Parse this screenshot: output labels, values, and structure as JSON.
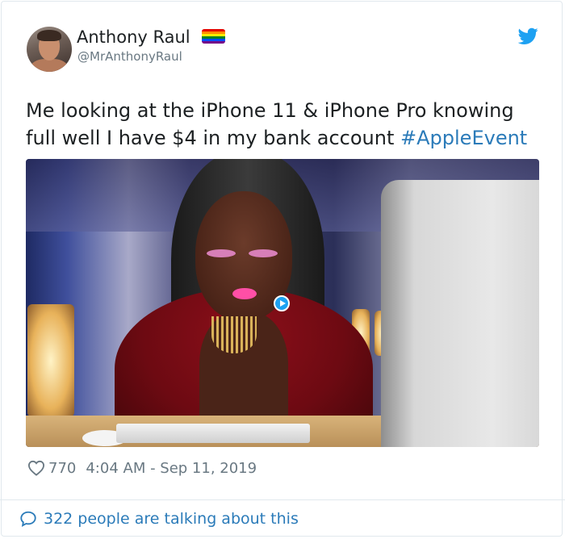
{
  "tweet": {
    "author_name": "Anthony Raul",
    "author_handle": "@MrAnthonyRaul",
    "flag_icon": "rainbow-flag-icon",
    "flag_colors": [
      "#e40303",
      "#ff8c00",
      "#ffed00",
      "#008026",
      "#004dff",
      "#750787"
    ],
    "brand_icon": "twitter-bird-icon",
    "brand_color": "#1da1f2",
    "text_part1": "Me looking at the iPhone 11 & iPhone Pro knowing full well I have $4 in my bank account ",
    "hashtag": "#AppleEvent",
    "media_icon": "gif-play-icon",
    "like_icon": "heart-icon",
    "likes": "770",
    "timestamp": "4:04 AM - Sep 11, 2019"
  },
  "footer": {
    "icon": "speech-bubble-icon",
    "talking_text": "322 people are talking about this"
  }
}
